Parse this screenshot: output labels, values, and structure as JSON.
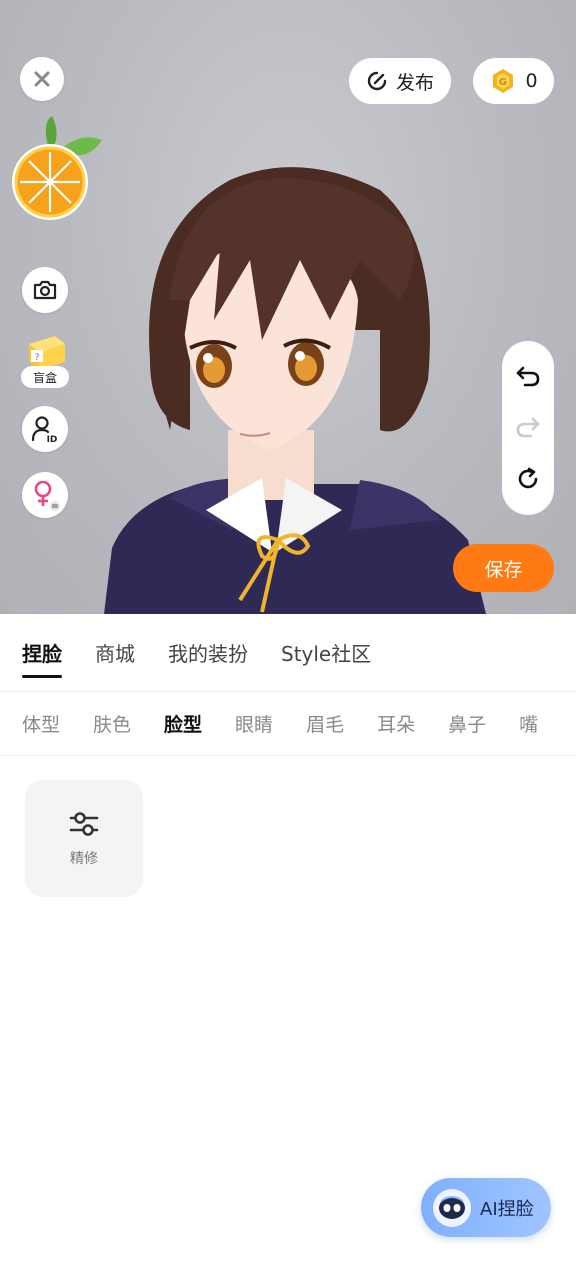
{
  "toolbar": {
    "publish_label": "发布",
    "coin_count": "0"
  },
  "side_tools": {
    "blindbox_label": "盲盒",
    "id_badge": "ID",
    "blindbox_mark": "?"
  },
  "actions": {
    "save_label": "保存"
  },
  "main_tabs": [
    {
      "label": "捏脸",
      "active": true
    },
    {
      "label": "商城",
      "active": false
    },
    {
      "label": "我的装扮",
      "active": false
    },
    {
      "label": "Style社区",
      "active": false
    }
  ],
  "sub_tabs": [
    {
      "label": "体型",
      "active": false
    },
    {
      "label": "肤色",
      "active": false
    },
    {
      "label": "脸型",
      "active": true
    },
    {
      "label": "眼睛",
      "active": false
    },
    {
      "label": "眉毛",
      "active": false
    },
    {
      "label": "耳朵",
      "active": false
    },
    {
      "label": "鼻子",
      "active": false
    },
    {
      "label": "嘴",
      "active": false
    }
  ],
  "tool_card": {
    "label": "精修"
  },
  "ai_button": {
    "label": "AI捏脸"
  },
  "colors": {
    "accent_orange": "#ff7a12",
    "coin_gold": "#f2b51c",
    "ai_blue": "#8ab8ff"
  }
}
